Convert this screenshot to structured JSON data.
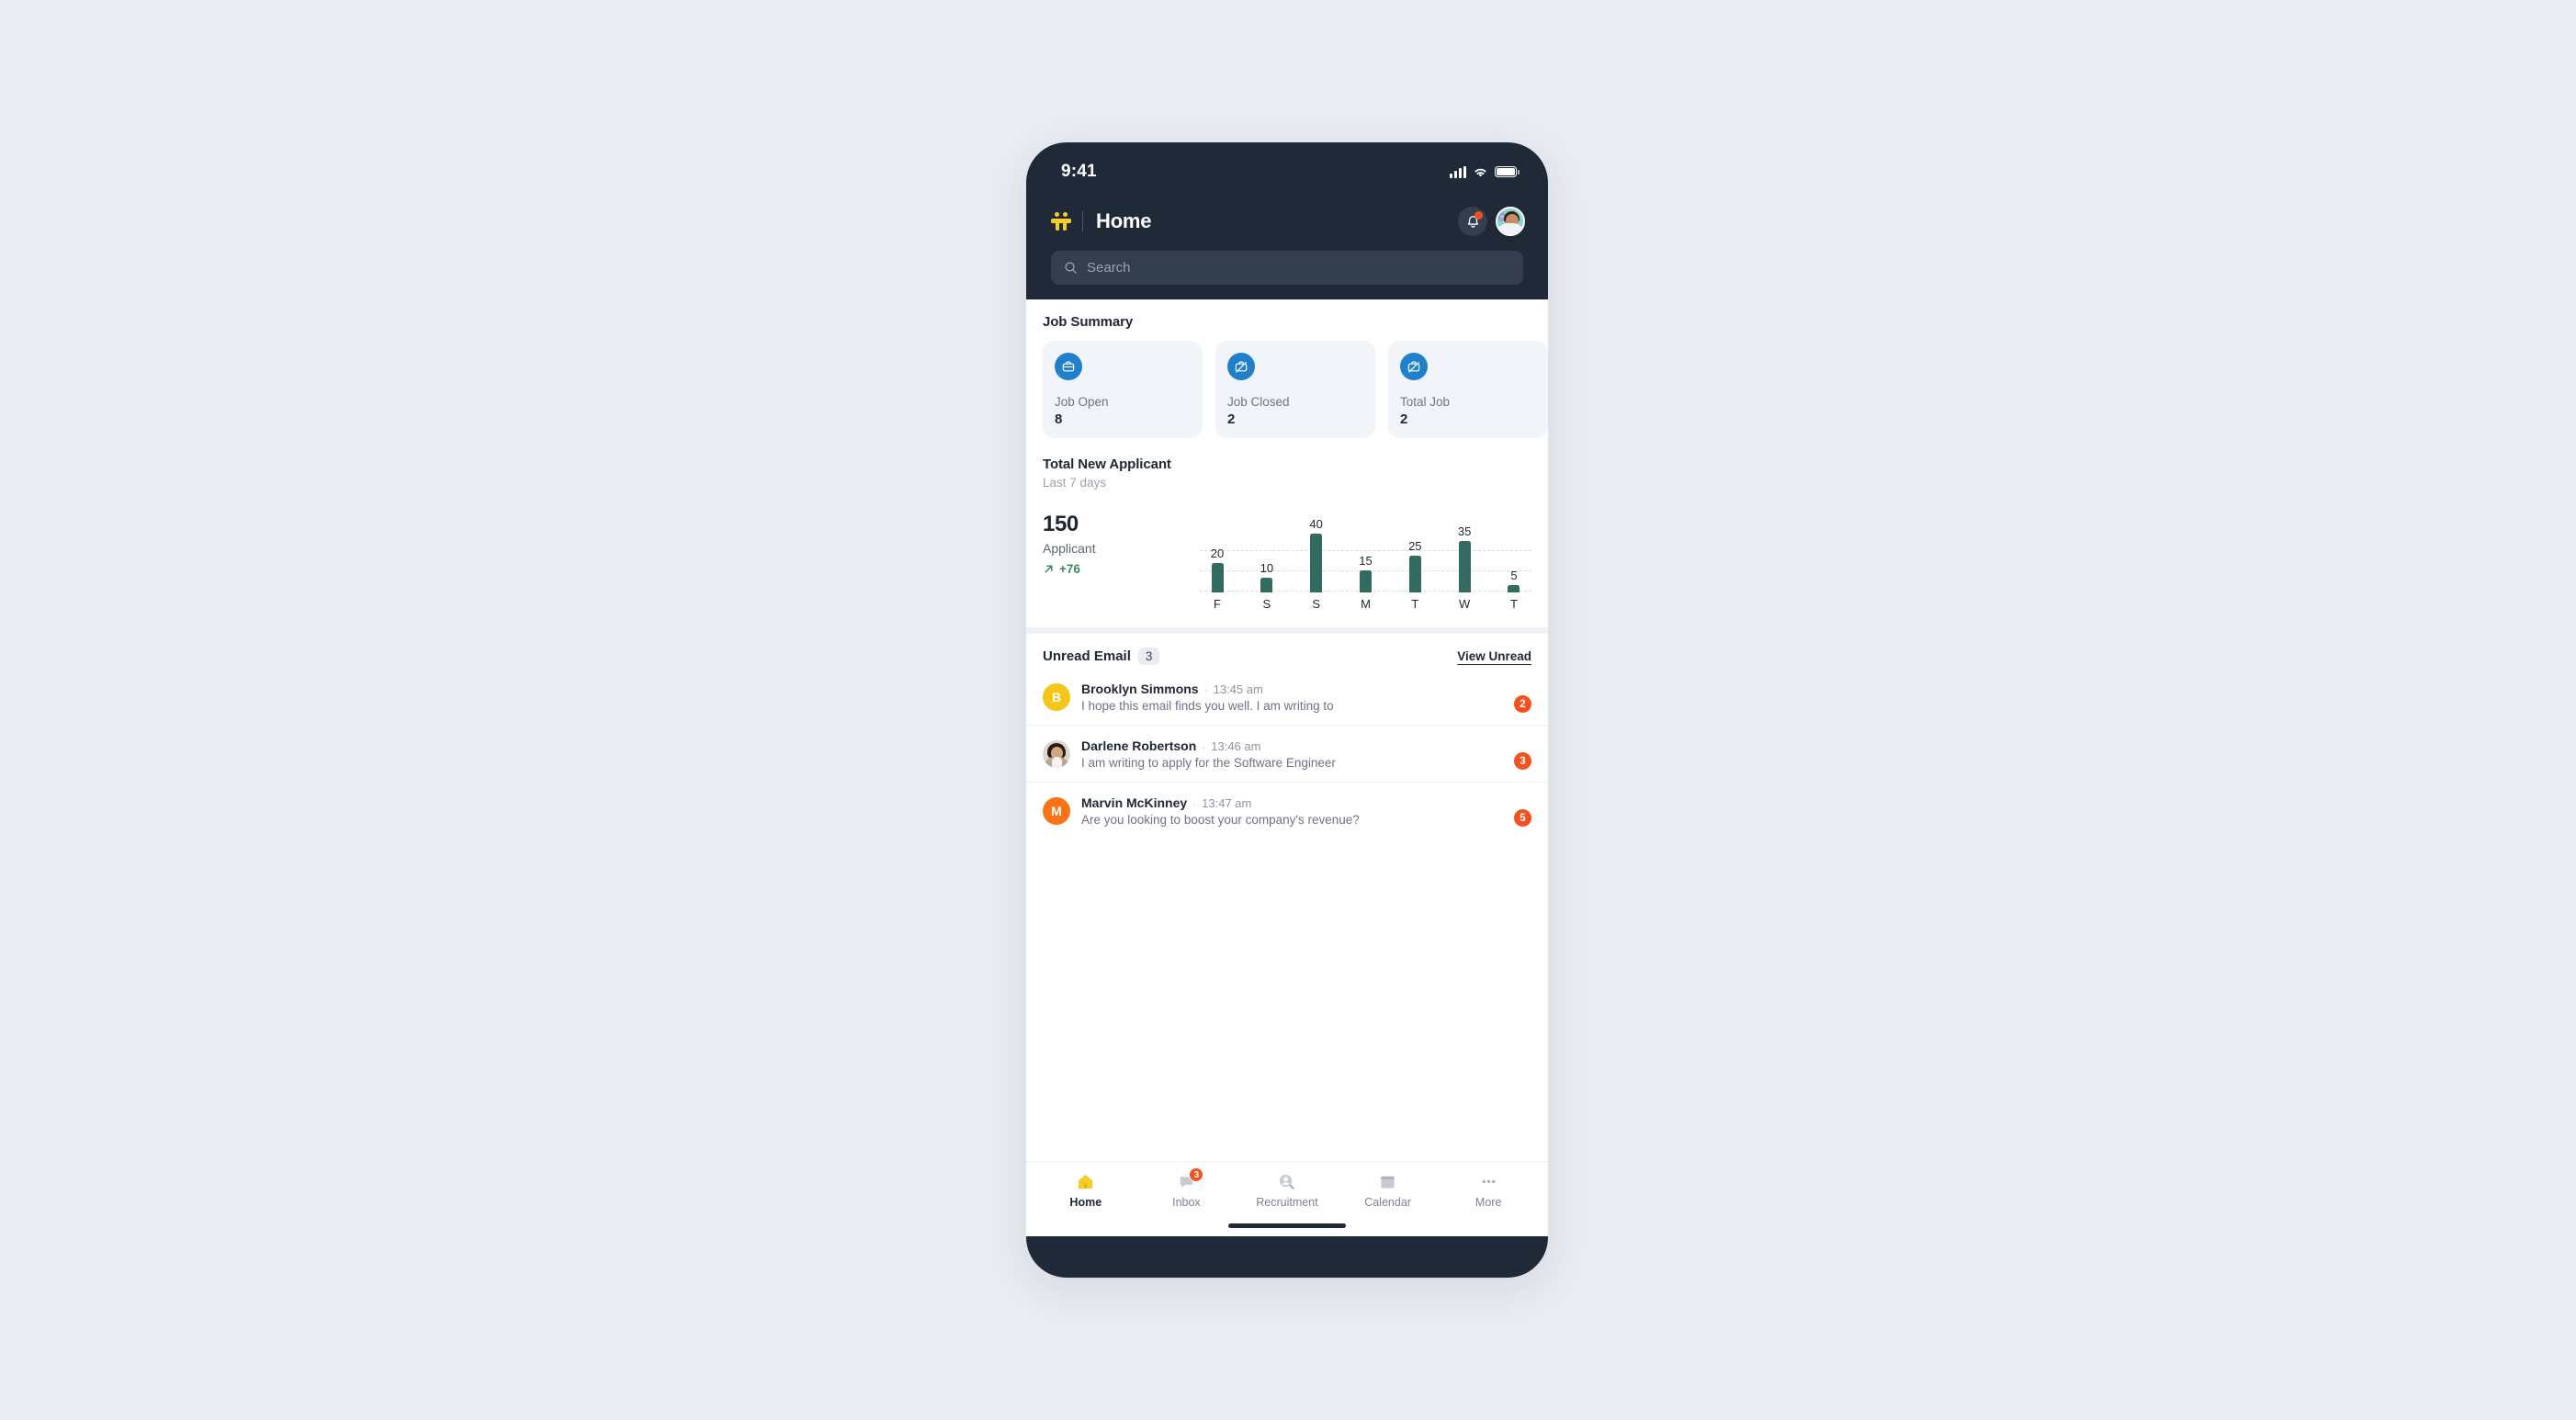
{
  "status_bar": {
    "time": "9:41"
  },
  "header": {
    "title": "Home",
    "logo_icon": "people-logo-icon",
    "bell_icon": "bell-icon",
    "avatar_icon": "user-avatar"
  },
  "search": {
    "placeholder": "Search",
    "value": "",
    "icon": "search-icon"
  },
  "job_summary": {
    "title": "Job Summary",
    "cards": [
      {
        "label": "Job Open",
        "value": "8",
        "icon": "briefcase-icon"
      },
      {
        "label": "Job Closed",
        "value": "2",
        "icon": "briefcase-slash-icon"
      },
      {
        "label": "Total Job",
        "value": "2",
        "icon": "briefcase-slash-icon"
      }
    ]
  },
  "applicant": {
    "title": "Total New Applicant",
    "subtitle": "Last 7 days",
    "total": "150",
    "unit": "Applicant",
    "delta": "+76",
    "delta_icon": "arrow-up-right-icon",
    "delta_color": "#3d8b5f"
  },
  "chart_data": {
    "type": "bar",
    "title": "Total New Applicant",
    "subtitle": "Last 7 days",
    "categories": [
      "F",
      "S",
      "S",
      "M",
      "T",
      "W",
      "T"
    ],
    "values": [
      20,
      10,
      40,
      15,
      25,
      35,
      5
    ],
    "xlabel": "",
    "ylabel": "",
    "ylim": [
      0,
      40
    ],
    "grid": true,
    "gridlines": [
      10,
      20,
      30
    ],
    "bar_color": "#346b61",
    "data_labels": true,
    "legend": "none",
    "total": 150
  },
  "unread_email": {
    "title": "Unread Email",
    "count": "3",
    "action_label": "View Unread",
    "rows": [
      {
        "name": "Brooklyn Simmons",
        "time": "13:45 am",
        "preview": "I hope this email finds you well. I am writing to",
        "badge": "2",
        "avatar_type": "initial",
        "initial": "B",
        "avatar_color": "#f5c518"
      },
      {
        "name": "Darlene Robertson",
        "time": "13:46 am",
        "preview": "I am writing to apply for the Software Engineer",
        "badge": "3",
        "avatar_type": "photo",
        "initial": "",
        "avatar_color": "#ddd6d0"
      },
      {
        "name": "Marvin McKinney",
        "time": "13:47 am",
        "preview": "Are you looking to boost your company's revenue?",
        "badge": "5",
        "avatar_type": "initial",
        "initial": "M",
        "avatar_color": "#f97316"
      }
    ]
  },
  "bottom_nav": {
    "items": [
      {
        "label": "Home",
        "icon": "home-icon",
        "active": true,
        "badge": ""
      },
      {
        "label": "Inbox",
        "icon": "inbox-icon",
        "active": false,
        "badge": "3"
      },
      {
        "label": "Recruitment",
        "icon": "recruitment-icon",
        "active": false,
        "badge": ""
      },
      {
        "label": "Calendar",
        "icon": "calendar-icon",
        "active": false,
        "badge": ""
      },
      {
        "label": "More",
        "icon": "more-dots-icon",
        "active": false,
        "badge": ""
      }
    ]
  }
}
